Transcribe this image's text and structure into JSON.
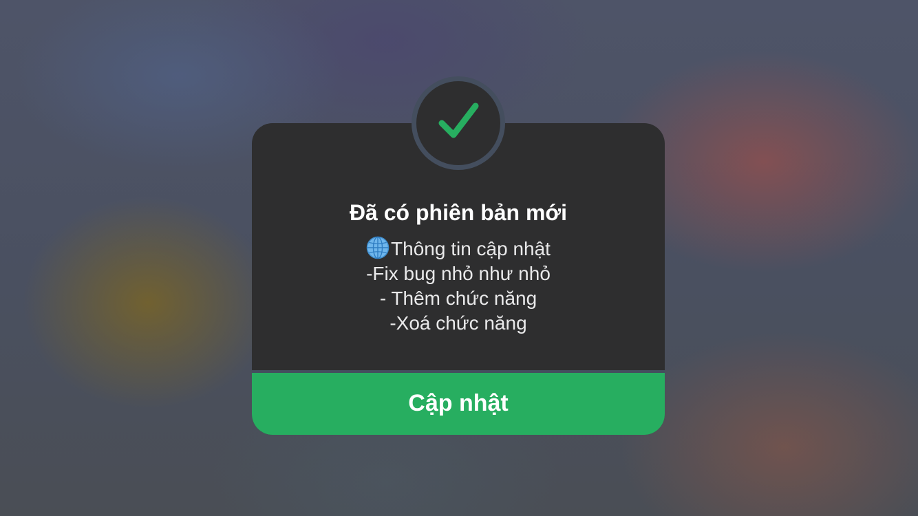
{
  "dialog": {
    "title": "Đã có phiên bản mới",
    "icon": "check-icon",
    "body_icon": "globe-icon",
    "body_lines": [
      "Thông tin cập nhật",
      "-Fix bug nhỏ như nhỏ",
      "- Thêm chức năng",
      "-Xoá chức năng"
    ],
    "button_label": "Cập nhật"
  },
  "colors": {
    "accent": "#27ae60",
    "dialog_background": "#2e2e2f",
    "ring": "#444e5e",
    "text": "#ffffff"
  }
}
